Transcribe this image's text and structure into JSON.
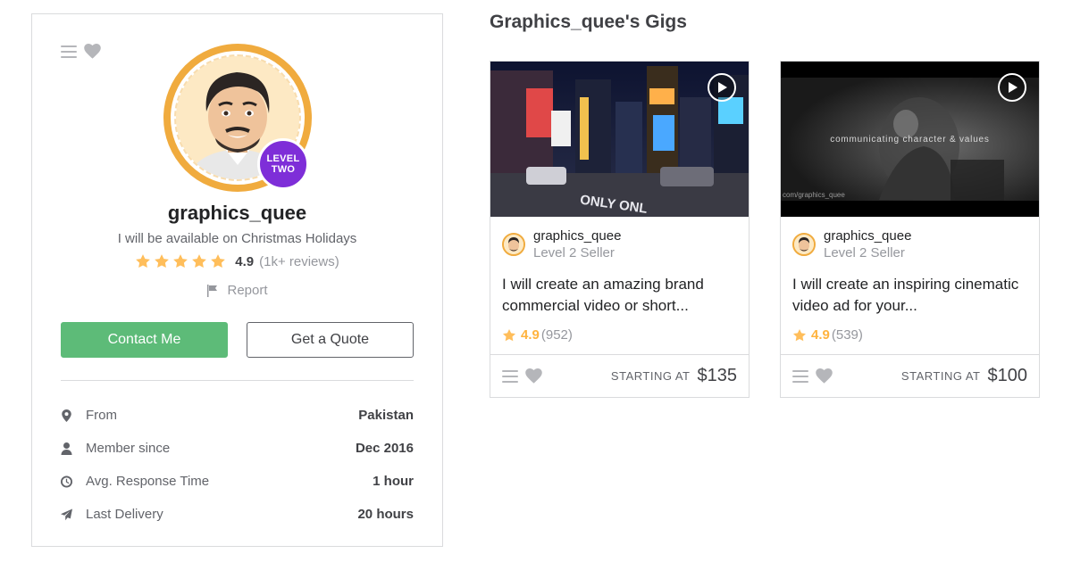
{
  "seller": {
    "username": "graphics_quee",
    "tagline": "I will be available on Christmas Holidays",
    "level_badge": [
      "LEVEL",
      "TWO"
    ],
    "rating": "4.9",
    "reviews": "(1k+ reviews)",
    "report_label": "Report",
    "contact_button": "Contact Me",
    "quote_button": "Get a Quote",
    "stats": [
      {
        "label": "From",
        "value": "Pakistan",
        "icon": "location-pin-icon"
      },
      {
        "label": "Member since",
        "value": "Dec 2016",
        "icon": "user-icon"
      },
      {
        "label": "Avg. Response Time",
        "value": "1 hour",
        "icon": "clock-icon"
      },
      {
        "label": "Last Delivery",
        "value": "20 hours",
        "icon": "paper-plane-icon"
      }
    ]
  },
  "gigs_section": {
    "title": "Graphics_quee's Gigs",
    "starting_at_label": "STARTING AT",
    "gigs": [
      {
        "seller_name": "graphics_quee",
        "seller_level": "Level 2 Seller",
        "description": "I will create an amazing brand commercial video or short...",
        "rating": "4.9",
        "count": "(952)",
        "price": "$135",
        "thumbnail": "times-square-night-photo"
      },
      {
        "seller_name": "graphics_quee",
        "seller_level": "Level 2 Seller",
        "description": "I will create an inspiring cinematic video ad for your...",
        "rating": "4.9",
        "count": "(539)",
        "price": "$100",
        "thumbnail": "cinematic-dark-photo",
        "overlay_text": "communicating character & values",
        "overlay_url": "com/graphics_quee"
      }
    ]
  },
  "colors": {
    "accent_green": "#5dbb78",
    "star_gold": "#ffbe5b",
    "level_purple": "#7e2ed8",
    "ring_orange": "#f0ab3e"
  }
}
